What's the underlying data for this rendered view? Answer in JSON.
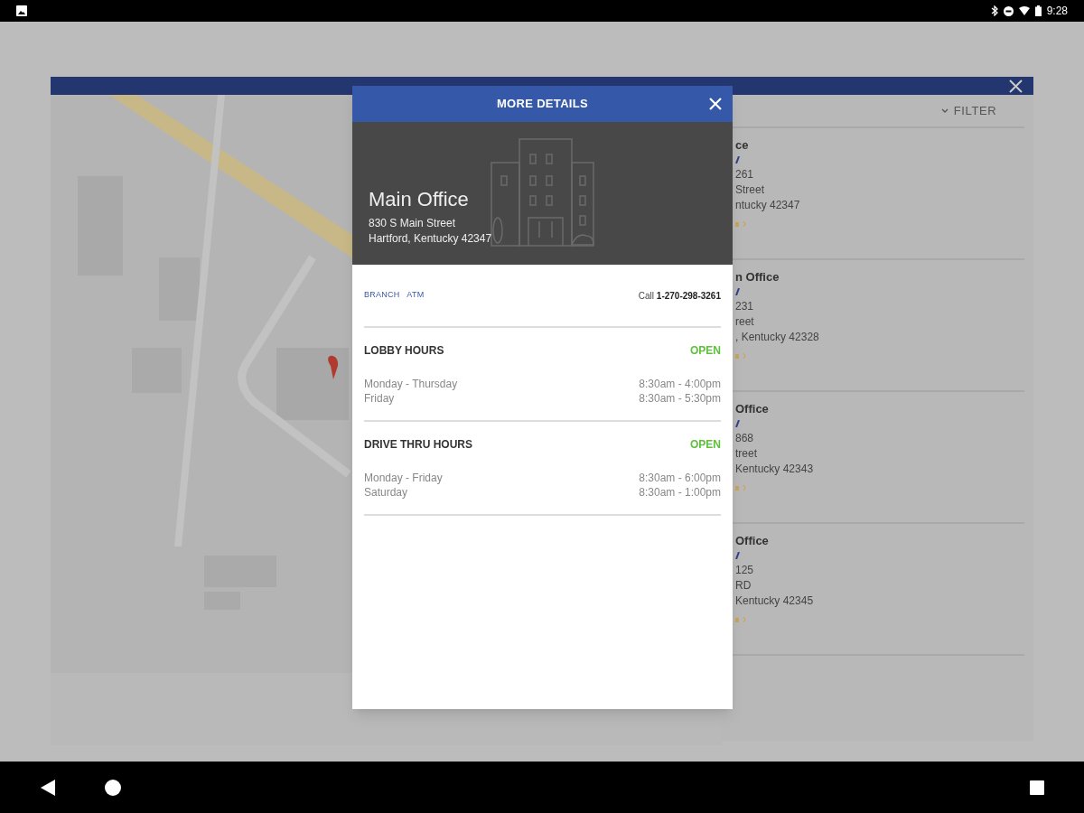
{
  "status_bar": {
    "time": "9:28"
  },
  "filter": {
    "label": "FILTER"
  },
  "locations": [
    {
      "name": "ce",
      "phone": "261",
      "street": "Street",
      "city": "ntucky 42347"
    },
    {
      "name": "n Office",
      "phone": "231",
      "street": "reet",
      "city": ", Kentucky 42328"
    },
    {
      "name": "Office",
      "phone": "868",
      "street": "treet",
      "city": "Kentucky 42343"
    },
    {
      "name": "Office",
      "phone": "125",
      "street": "RD",
      "city": "Kentucky 42345"
    }
  ],
  "dialog": {
    "title": "MORE DETAILS",
    "name": "Main Office",
    "address_lines": [
      "830 S Main Street",
      "Hartford, Kentucky 42347"
    ],
    "tags": [
      "BRANCH",
      "ATM"
    ],
    "call_label": "Call",
    "phone": "1-270-298-3261",
    "sections": [
      {
        "title": "LOBBY HOURS",
        "status": "OPEN",
        "rows": [
          {
            "days": "Monday - Thursday",
            "hours": "8:30am - 4:00pm"
          },
          {
            "days": "Friday",
            "hours": "8:30am - 5:30pm"
          }
        ]
      },
      {
        "title": "DRIVE THRU HOURS",
        "status": "OPEN",
        "rows": [
          {
            "days": "Monday - Friday",
            "hours": "8:30am - 6:00pm"
          },
          {
            "days": "Saturday",
            "hours": "8:30am - 1:00pm"
          }
        ]
      }
    ]
  }
}
